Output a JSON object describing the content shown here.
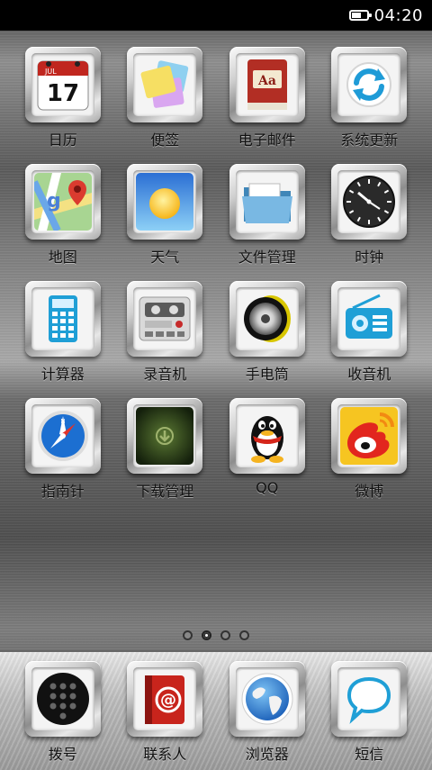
{
  "status_bar": {
    "time": "04:20",
    "battery_level": 0.7
  },
  "apps": [
    {
      "name": "calendar-app",
      "icon": "calendar-icon",
      "label": "日历",
      "calendar_month": "JUL",
      "calendar_day": "17"
    },
    {
      "name": "notes-app",
      "icon": "sticky-notes-icon",
      "label": "便签"
    },
    {
      "name": "email-app",
      "icon": "mail-book-icon",
      "label": "电子邮件",
      "badge_text": "Aa"
    },
    {
      "name": "system-update-app",
      "icon": "sync-icon",
      "label": "系统更新"
    },
    {
      "name": "maps-app",
      "icon": "map-pin-icon",
      "label": "地图"
    },
    {
      "name": "weather-app",
      "icon": "sun-icon",
      "label": "天气"
    },
    {
      "name": "file-manager-app",
      "icon": "folder-icon",
      "label": "文件管理"
    },
    {
      "name": "clock-app",
      "icon": "clock-icon",
      "label": "时钟"
    },
    {
      "name": "calculator-app",
      "icon": "calculator-icon",
      "label": "计算器"
    },
    {
      "name": "recorder-app",
      "icon": "tape-recorder-icon",
      "label": "录音机"
    },
    {
      "name": "flashlight-app",
      "icon": "flashlight-icon",
      "label": "手电筒"
    },
    {
      "name": "radio-app",
      "icon": "radio-icon",
      "label": "收音机"
    },
    {
      "name": "compass-app",
      "icon": "compass-icon",
      "label": "指南针"
    },
    {
      "name": "download-manager-app",
      "icon": "download-icon",
      "label": "下载管理"
    },
    {
      "name": "qq-app",
      "icon": "penguin-icon",
      "label": "QQ"
    },
    {
      "name": "weibo-app",
      "icon": "weibo-eye-icon",
      "label": "微博"
    }
  ],
  "page_indicator": {
    "count": 4,
    "active": 1
  },
  "dock": [
    {
      "name": "dialer-app",
      "icon": "keypad-icon",
      "label": "拨号"
    },
    {
      "name": "contacts-app",
      "icon": "address-book-icon",
      "label": "联系人"
    },
    {
      "name": "browser-app",
      "icon": "globe-icon",
      "label": "浏览器"
    },
    {
      "name": "messages-app",
      "icon": "speech-bubble-icon",
      "label": "短信"
    }
  ]
}
